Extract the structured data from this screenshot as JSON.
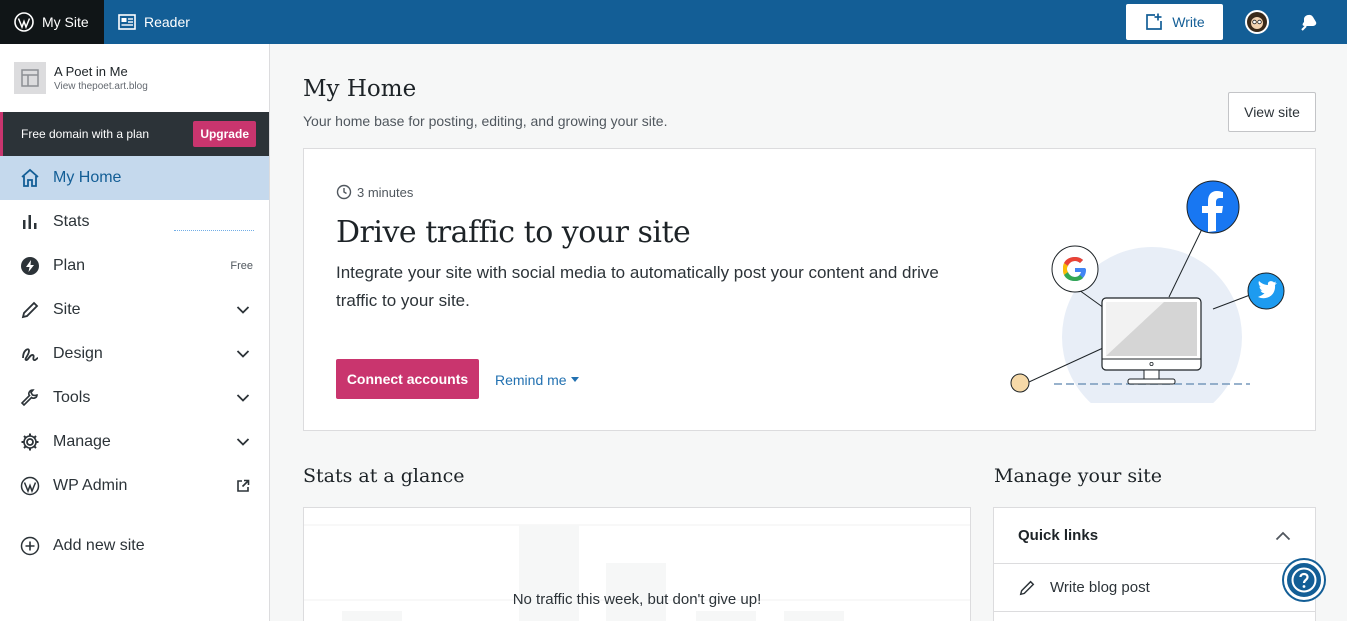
{
  "masterbar": {
    "my_site": "My Site",
    "reader": "Reader",
    "write": "Write"
  },
  "sidebar": {
    "site_name": "A Poet in Me",
    "site_url": "View thepoet.art.blog",
    "promo_text": "Free domain with a plan",
    "upgrade": "Upgrade",
    "items": [
      {
        "label": "My Home",
        "icon": "home-icon"
      },
      {
        "label": "Stats",
        "icon": "stats-icon"
      },
      {
        "label": "Plan",
        "icon": "plan-icon",
        "badge": "Free"
      },
      {
        "label": "Site",
        "icon": "pencil-icon"
      },
      {
        "label": "Design",
        "icon": "design-icon"
      },
      {
        "label": "Tools",
        "icon": "wrench-icon"
      },
      {
        "label": "Manage",
        "icon": "gear-icon"
      },
      {
        "label": "WP Admin",
        "icon": "wordpress-icon"
      },
      {
        "label": "Add new site",
        "icon": "plus-circle-icon"
      }
    ]
  },
  "main": {
    "title": "My Home",
    "subtitle": "Your home base for posting, editing, and growing your site.",
    "view_site": "View site",
    "card": {
      "time": "3 minutes",
      "title": "Drive traffic to your site",
      "description": "Integrate your site with social media to automatically post your content and drive traffic to your site.",
      "connect": "Connect accounts",
      "remind": "Remind me"
    },
    "stats_title": "Stats at a glance",
    "stats_message": "No traffic this week, but don't give up!",
    "manage_title": "Manage your site",
    "quick_links": "Quick links",
    "write_post": "Write blog post"
  },
  "colors": {
    "masterbar": "#135e96",
    "accent": "#c9356e",
    "active_nav": "#c5d9ed"
  }
}
